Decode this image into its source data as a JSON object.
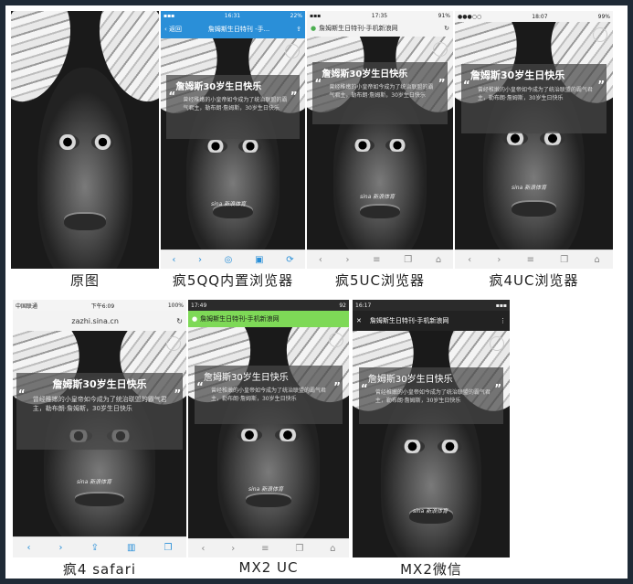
{
  "captions": {
    "original": "原图",
    "crazy5_qq": "疯5QQ内置浏览器",
    "crazy5_uc": "疯5UC浏览器",
    "crazy4_uc": "疯4UC浏览器",
    "crazy4_safari": "疯4 safari",
    "mx2_uc": "MX2 UC",
    "mx2_wechat": "MX2微信"
  },
  "overlay": {
    "title": "詹姆斯30岁生日快乐",
    "body": "曾经稚嫩的小皇帝如今成为了统治联盟的霸气君主，勒布朗·詹姆斯，30岁生日快乐",
    "quote_open": "“",
    "quote_close": "”"
  },
  "watermark": "sina 新浪体育",
  "phones": {
    "qq": {
      "time": "16:31",
      "battery": "22%",
      "back_label": "返回",
      "title": "詹姆斯生日特刊 -手..."
    },
    "uc5": {
      "time": "17:35",
      "battery": "91%",
      "title": "詹姆斯生日特刊-手机新浪网"
    },
    "uc4": {
      "time": "18:07",
      "battery": "99%"
    },
    "safari": {
      "carrier": "中国联通",
      "time": "下午6:09",
      "battery": "100%",
      "url": "zazhi.sina.cn"
    },
    "mx2uc": {
      "time": "17:49",
      "battery": "92",
      "title": "詹姆斯生日特刊-手机新浪网"
    },
    "mx2wechat": {
      "time": "16:17",
      "title": "詹姆斯生日特刊-手机新浪网",
      "close": "✕",
      "menu": "⋮"
    }
  }
}
